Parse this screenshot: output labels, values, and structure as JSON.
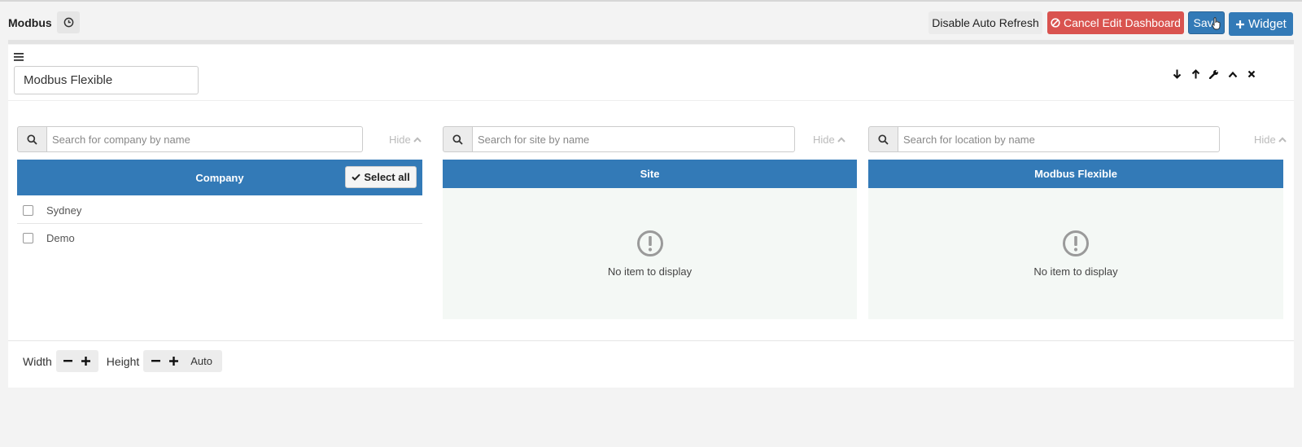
{
  "header": {
    "title": "Modbus",
    "disable_refresh_label": "Disable Auto Refresh",
    "cancel_edit_label": "Cancel Edit Dashboard",
    "save_label": "Save",
    "add_widget_label": "Widget",
    "accent_color": "#337ab7",
    "danger_color": "#d9534f"
  },
  "widget": {
    "title_value": "Modbus Flexible",
    "controls": [
      "arrow-down-icon",
      "arrow-up-icon",
      "wrench-icon",
      "chevron-up-icon",
      "close-icon"
    ]
  },
  "columns": {
    "company": {
      "search_placeholder": "Search for company by name",
      "hide_label": "Hide",
      "header": "Company",
      "select_all_label": "Select all",
      "items": [
        {
          "label": "Sydney",
          "checked": false
        },
        {
          "label": "Demo",
          "checked": false
        }
      ]
    },
    "site": {
      "search_placeholder": "Search for site by name",
      "hide_label": "Hide",
      "header": "Site",
      "empty_text": "No item to display"
    },
    "location": {
      "search_placeholder": "Search for location by name",
      "hide_label": "Hide",
      "header": "Modbus Flexible",
      "empty_text": "No item to display"
    }
  },
  "footer": {
    "width_label": "Width",
    "height_label": "Height",
    "auto_label": "Auto"
  }
}
